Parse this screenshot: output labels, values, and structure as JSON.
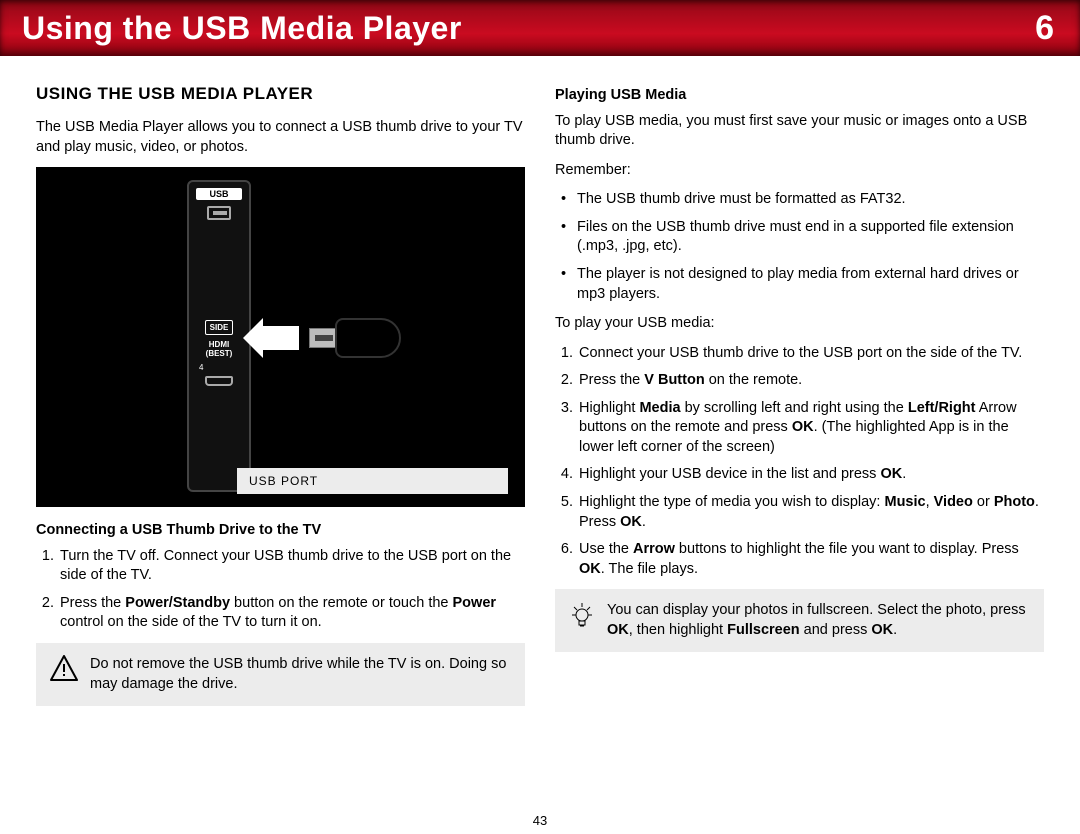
{
  "header": {
    "title": "Using the USB Media Player",
    "chapter": "6"
  },
  "left": {
    "section_head": "USING THE USB MEDIA PLAYER",
    "intro": "The USB Media Player allows you to connect a USB thumb drive to your TV and play music, video, or photos.",
    "figure": {
      "caption": "USB PORT",
      "port_usb": "USB",
      "port_side": "SIDE",
      "port_hdmi_line1": "HDMI",
      "port_hdmi_line2": "(BEST)",
      "port_num": "4"
    },
    "connecting_head": "Connecting a USB Thumb Drive to the TV",
    "connect_steps": {
      "s1": "Turn the TV off. Connect your USB thumb drive to the USB port on the side of the TV.",
      "s2_pre": "Press the ",
      "s2_b1": "Power/Standby",
      "s2_mid": " button on the remote or touch the ",
      "s2_b2": "Power",
      "s2_post": " control on the side of the TV to turn it on."
    },
    "warning": "Do not remove the USB thumb drive while the TV is on. Doing so may damage the drive."
  },
  "right": {
    "playing_head": "Playing USB Media",
    "intro": "To play USB media, you must first save your music or images onto a USB thumb drive.",
    "remember_label": "Remember:",
    "remember": {
      "r1": "The USB thumb drive must be formatted as FAT32.",
      "r2": "Files on the USB thumb drive must end in a supported file extension (.mp3, .jpg, etc).",
      "r3": "The player is not designed to play media from external hard drives or mp3 players."
    },
    "to_play_label": "To play your USB media:",
    "play_steps": {
      "p1": "Connect your USB thumb drive to the USB port on the side of the TV.",
      "p2_pre": "Press the ",
      "p2_b1": "V Button",
      "p2_post": " on the remote.",
      "p3_pre": "Highlight ",
      "p3_b1": "Media",
      "p3_mid1": " by scrolling left and right using the ",
      "p3_b2": "Left/Right",
      "p3_mid2": " Arrow buttons on the remote and press ",
      "p3_b3": "OK",
      "p3_post": ". (The highlighted App is in the lower left corner of the screen)",
      "p4_pre": "Highlight your USB device in the list and press ",
      "p4_b1": "OK",
      "p4_post": ".",
      "p5_pre": "Highlight the type of media you wish to display: ",
      "p5_b1": "Music",
      "p5_sep1": ", ",
      "p5_b2": "Video",
      "p5_mid": " or ",
      "p5_b3": "Photo",
      "p5_mid2": ". Press ",
      "p5_b4": "OK",
      "p5_post": ".",
      "p6_pre": "Use the ",
      "p6_b1": "Arrow",
      "p6_mid": " buttons to highlight the file you want to display. Press ",
      "p6_b2": "OK",
      "p6_post": ". The file plays."
    },
    "tip": {
      "t_pre": "You can display your photos in fullscreen. Select the photo, press ",
      "t_b1": "OK",
      "t_mid": ", then highlight ",
      "t_b2": "Fullscreen",
      "t_mid2": " and press ",
      "t_b3": "OK",
      "t_post": "."
    }
  },
  "footer": {
    "page": "43"
  }
}
